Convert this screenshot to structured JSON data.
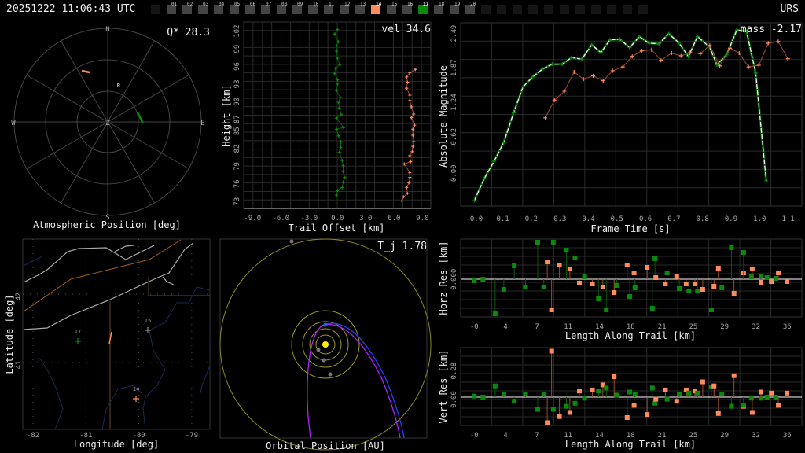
{
  "header": {
    "timestamp": "20251222 11:06:43 UTC",
    "site": "URS"
  },
  "stations": [
    {
      "id": "",
      "state": "empty"
    },
    {
      "id": "01",
      "state": "idle"
    },
    {
      "id": "02",
      "state": "idle"
    },
    {
      "id": "03",
      "state": "idle"
    },
    {
      "id": "04",
      "state": "idle"
    },
    {
      "id": "05",
      "state": "idle"
    },
    {
      "id": "06",
      "state": "idle"
    },
    {
      "id": "07",
      "state": "idle"
    },
    {
      "id": "08",
      "state": "idle"
    },
    {
      "id": "09",
      "state": "idle"
    },
    {
      "id": "10",
      "state": "idle"
    },
    {
      "id": "11",
      "state": "idle"
    },
    {
      "id": "12",
      "state": "idle"
    },
    {
      "id": "13",
      "state": "idle"
    },
    {
      "id": "14",
      "state": "orange"
    },
    {
      "id": "15",
      "state": "idle"
    },
    {
      "id": "16",
      "state": "idle"
    },
    {
      "id": "17",
      "state": "green"
    },
    {
      "id": "18",
      "state": "idle"
    },
    {
      "id": "19",
      "state": "idle"
    },
    {
      "id": "20",
      "state": "idle"
    },
    {
      "id": "",
      "state": "empty"
    },
    {
      "id": "",
      "state": "empty"
    },
    {
      "id": "",
      "state": "empty"
    },
    {
      "id": "",
      "state": "empty"
    },
    {
      "id": "",
      "state": "empty"
    },
    {
      "id": "",
      "state": "empty"
    },
    {
      "id": "",
      "state": "empty"
    },
    {
      "id": "",
      "state": "empty"
    },
    {
      "id": "",
      "state": "empty"
    },
    {
      "id": "",
      "state": "empty"
    },
    {
      "id": "",
      "state": "empty"
    }
  ],
  "colors": {
    "green": "#0a8a0a",
    "orange": "#ff8a5c",
    "grid": "#333333",
    "gray": "#888888",
    "white": "#ffffff"
  },
  "polar": {
    "title": "Atmospheric Position [deg]",
    "metric": "Q* 28.3",
    "dirs": {
      "n": "N",
      "s": "S",
      "e": "E",
      "w": "W",
      "z": "Z"
    },
    "radiant_label": "R"
  },
  "height_chart": {
    "title_value": "vel 34.6",
    "xlabel": "Trail Offset [km]",
    "ylabel": "Height [km]",
    "xticks": [
      "-9.0",
      "-6.0",
      "-3.0",
      "0.0",
      "3.0",
      "6.0",
      "9.0"
    ],
    "yticks": [
      "73",
      "76",
      "79",
      "82",
      "85",
      "87",
      "90",
      "93",
      "96",
      "99",
      "102"
    ],
    "chart_data": {
      "type": "line",
      "xlim": [
        -10,
        10
      ],
      "ylim": [
        72,
        103
      ],
      "series": [
        {
          "name": "17",
          "color": "green",
          "x": [
            0,
            -0.3,
            0.1,
            -0.1,
            -0.1,
            0,
            0.25,
            -0.2,
            -0.3,
            0,
            0,
            -0.1,
            0.3,
            0.1,
            0.2,
            0.4,
            -0.1,
            0.65,
            -0.1,
            0.1,
            0.35,
            0.35,
            0.2,
            0.5,
            0.6,
            0.6,
            0.75,
            0.6,
            0.5,
            0,
            -0.1
          ],
          "y": [
            101.9,
            101.1,
            99.8,
            99.1,
            98.2,
            97.0,
            95.9,
            95.3,
            94.4,
            93.3,
            92.6,
            91.5,
            90.3,
            89.5,
            88.5,
            87.4,
            86.8,
            85.2,
            84.9,
            83.8,
            82.8,
            81.8,
            81.0,
            79.6,
            78.7,
            77.7,
            76.7,
            75.9,
            75.0,
            74.5,
            73.7
          ]
        },
        {
          "name": "14",
          "color": "orange",
          "x": [
            8.25,
            7.67,
            7.33,
            7.42,
            7.33,
            7.67,
            7.67,
            7.83,
            8.08,
            7.83,
            8.17,
            8.0,
            8.0,
            8.08,
            8.0,
            7.92,
            7.67,
            7.75,
            7.08,
            7.67,
            7.67,
            7.58,
            7.33,
            7.42,
            7.0,
            6.83
          ],
          "y": [
            95.1,
            94.5,
            93.8,
            92.9,
            91.9,
            90.7,
            89.8,
            88.7,
            87.5,
            86.9,
            85.6,
            84.9,
            83.9,
            82.8,
            82.0,
            81.1,
            80.4,
            79.4,
            79.0,
            77.5,
            76.7,
            75.8,
            75.0,
            74.0,
            73.4,
            72.7
          ]
        }
      ]
    }
  },
  "mag_chart": {
    "title_value": "mass -2.17",
    "xlabel": "Frame Time [s]",
    "ylabel": "Absolute Magnitude",
    "xticks": [
      "-0.0",
      "0.1",
      "0.2",
      "0.3",
      "0.4",
      "0.5",
      "0.6",
      "0.7",
      "0.8",
      "0.9",
      "1.0",
      "1.1"
    ],
    "yticks": [
      "0.00",
      "-0.62",
      "-1.24",
      "-1.87",
      "-2.49"
    ],
    "chart_data": {
      "type": "line",
      "xlim": [
        -0.045,
        1.15
      ],
      "ylim": [
        0.62,
        -2.7
      ],
      "series": [
        {
          "name": "17",
          "color": "green",
          "x": [
            0,
            0.035,
            0.07,
            0.103,
            0.138,
            0.171,
            0.205,
            0.239,
            0.273,
            0.309,
            0.341,
            0.377,
            0.412,
            0.444,
            0.476,
            0.511,
            0.545,
            0.579,
            0.613,
            0.648,
            0.682,
            0.717,
            0.751,
            0.783,
            0.825,
            0.851,
            0.885,
            0.921,
            0.955,
            0.987,
            1.024
          ],
          "y": [
            0.54,
            0.14,
            -0.18,
            -0.51,
            -1.05,
            -1.52,
            -1.7,
            -1.84,
            -1.93,
            -1.93,
            -2.05,
            -2.02,
            -2.28,
            -2.14,
            -2.37,
            -2.38,
            -2.23,
            -2.43,
            -2.31,
            -2.3,
            -2.48,
            -2.32,
            -2.07,
            -2.43,
            -2.24,
            -1.92,
            -2.1,
            -2.55,
            -2.52,
            -1.77,
            0.18
          ]
        },
        {
          "name": "14",
          "color": "orange",
          "x": [
            0.249,
            0.281,
            0.316,
            0.35,
            0.383,
            0.417,
            0.452,
            0.485,
            0.521,
            0.554,
            0.587,
            0.622,
            0.655,
            0.692,
            0.725,
            0.757,
            0.793,
            0.826,
            0.861,
            0.897,
            0.929,
            0.962,
            0.998,
            1.031,
            1.066,
            1.1
          ],
          "y": [
            -0.96,
            -1.28,
            -1.44,
            -1.79,
            -1.66,
            -1.72,
            -1.63,
            -1.81,
            -1.88,
            -2.07,
            -2.17,
            -2.19,
            -2.0,
            -2.13,
            -2.08,
            -2.14,
            -2.12,
            -2.27,
            -1.9,
            -2.22,
            -2.13,
            -1.88,
            -1.91,
            -2.31,
            -2.34,
            -2.03
          ]
        }
      ]
    }
  },
  "residuals": {
    "xlabel": "Length Along Trail [km]",
    "xticks": [
      "-0",
      "4",
      "7",
      "11",
      "14",
      "18",
      "21",
      "25",
      "29",
      "32",
      "36"
    ],
    "horz": {
      "ylabel": "Horz Res [km]",
      "yticks": [
        "-0.000"
      ]
    },
    "vert": {
      "ylabel": "Vert Res [km]",
      "yticks": [
        "0.00",
        "0.28"
      ]
    },
    "chart_data": {
      "type": "scatter",
      "xlim": [
        -1.5,
        38
      ],
      "columns": [
        "length_km",
        "horz_res",
        "vert_res",
        "station"
      ],
      "points": [
        [
          0,
          -0.02,
          0.01,
          "g"
        ],
        [
          1.0,
          0,
          0,
          "g"
        ],
        [
          2.4,
          -0.44,
          0.11,
          "g"
        ],
        [
          3.4,
          -0.13,
          0.03,
          "g"
        ],
        [
          4.6,
          0.17,
          -0.04,
          "g"
        ],
        [
          5.9,
          -0.1,
          0.03,
          "g"
        ],
        [
          7.3,
          0.47,
          -0.12,
          "g"
        ],
        [
          8.0,
          -0.1,
          0.03,
          "g"
        ],
        [
          8.4,
          0.22,
          -0.25,
          "o"
        ],
        [
          8.9,
          -0.39,
          0.45,
          "o"
        ],
        [
          9.1,
          0.47,
          -0.12,
          "g"
        ],
        [
          9.8,
          0.18,
          -0.19,
          "o"
        ],
        [
          10.6,
          0.37,
          -0.09,
          "g"
        ],
        [
          11.0,
          0.13,
          -0.15,
          "o"
        ],
        [
          11.6,
          0.27,
          -0.06,
          "g"
        ],
        [
          12.1,
          -0.05,
          0.06,
          "o"
        ],
        [
          12.7,
          0.03,
          -0.01,
          "g"
        ],
        [
          13.6,
          -0.06,
          0.07,
          "o"
        ],
        [
          14.3,
          -0.25,
          0.06,
          "g"
        ],
        [
          14.8,
          -0.1,
          0.12,
          "o"
        ],
        [
          15.2,
          -0.39,
          0.09,
          "g"
        ],
        [
          16.1,
          -0.17,
          0.2,
          "o"
        ],
        [
          16.4,
          -0.08,
          0.02,
          "g"
        ],
        [
          17.6,
          0.18,
          -0.2,
          "o"
        ],
        [
          17.9,
          -0.22,
          0.05,
          "g"
        ],
        [
          18.4,
          0.08,
          -0.08,
          "o"
        ],
        [
          18.5,
          -0.11,
          0.03,
          "g"
        ],
        [
          19.9,
          0.15,
          -0.17,
          "o"
        ],
        [
          20.5,
          -0.37,
          0.09,
          "g"
        ],
        [
          20.8,
          0.26,
          -0.06,
          "g"
        ],
        [
          20.9,
          0.02,
          -0.02,
          "o"
        ],
        [
          22.0,
          -0.06,
          0.07,
          "o"
        ],
        [
          22.2,
          0.08,
          -0.02,
          "g"
        ],
        [
          23.3,
          0.03,
          -0.04,
          "o"
        ],
        [
          23.6,
          -0.12,
          0.03,
          "g"
        ],
        [
          24.4,
          -0.06,
          0.07,
          "o"
        ],
        [
          24.7,
          -0.15,
          0.04,
          "g"
        ],
        [
          25.4,
          -0.06,
          0.06,
          "o"
        ],
        [
          25.7,
          -0.15,
          0.04,
          "g"
        ],
        [
          26.3,
          -0.13,
          0.15,
          "o"
        ],
        [
          27.3,
          -0.39,
          0.1,
          "g"
        ],
        [
          27.6,
          -0.09,
          0.11,
          "o"
        ],
        [
          28.1,
          0.14,
          -0.16,
          "o"
        ],
        [
          28.5,
          -0.11,
          0.03,
          "g"
        ],
        [
          29.6,
          0.4,
          -0.09,
          "g"
        ],
        [
          29.9,
          -0.18,
          0.21,
          "o"
        ],
        [
          31.0,
          0.08,
          -0.09,
          "o"
        ],
        [
          31.0,
          0.34,
          -0.08,
          "g"
        ],
        [
          31.9,
          0.03,
          -0.01,
          "g"
        ],
        [
          32.0,
          0.13,
          -0.15,
          "o"
        ],
        [
          33.0,
          0.04,
          -0.01,
          "g"
        ],
        [
          33.0,
          -0.04,
          0.05,
          "o"
        ],
        [
          33.7,
          0.02,
          0,
          "g"
        ],
        [
          34.2,
          -0.03,
          0.04,
          "o"
        ],
        [
          34.7,
          0.01,
          0,
          "g"
        ],
        [
          35.0,
          0.08,
          -0.08,
          "o"
        ],
        [
          36.0,
          -0.03,
          0.04,
          "o"
        ]
      ]
    }
  },
  "map": {
    "xlabel": "Longitude [deg]",
    "ylabel": "Latitude [deg]",
    "xticks": [
      "-82",
      "-81",
      "-80",
      "-79"
    ],
    "yticks": [
      "41",
      "42"
    ],
    "stations": [
      {
        "label": "17",
        "color": "green"
      },
      {
        "label": "15",
        "color": "gray"
      },
      {
        "label": "14",
        "color": "orange"
      }
    ]
  },
  "orbit": {
    "title": "Orbital Position [AU]",
    "metric": "T_j 1.78"
  }
}
